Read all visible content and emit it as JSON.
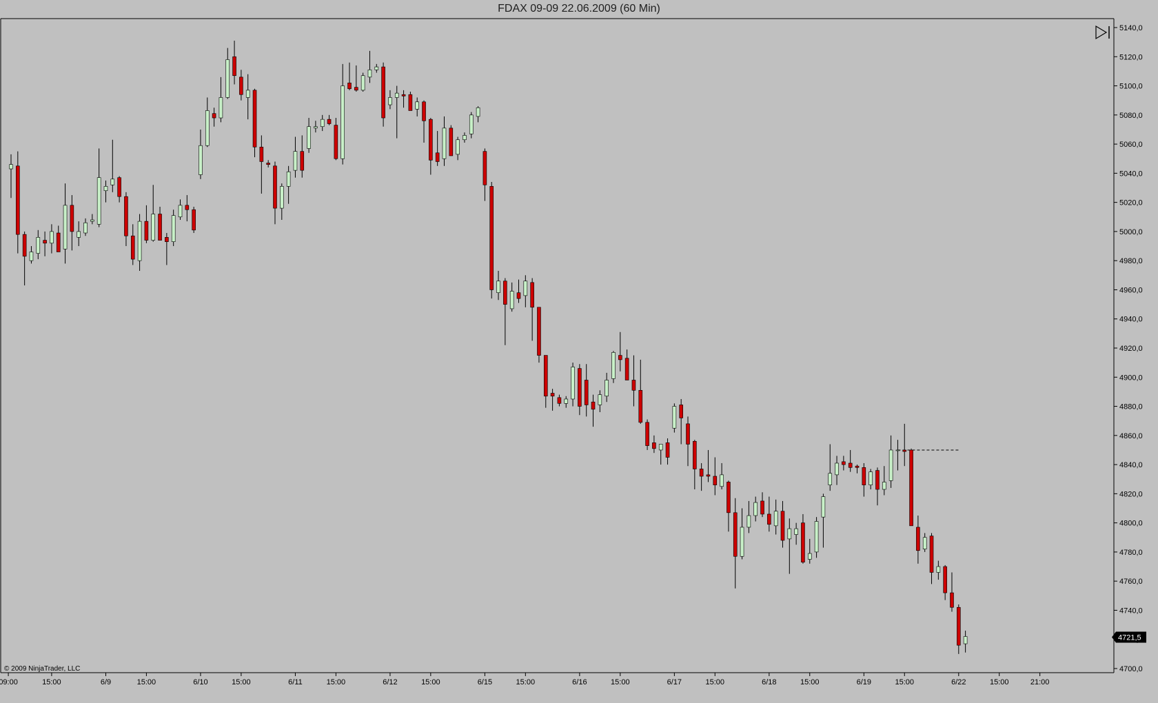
{
  "window": {
    "title": "FDAX 09-09  22.06.2009 (60 Min)"
  },
  "copyright": "© 2009 NinjaTrader, LLC",
  "colors": {
    "background": "#c0c0c0",
    "up": "#c8f0c8",
    "down": "#cc0000",
    "wick": "#000000",
    "outline": "#000000"
  },
  "icons": {
    "scroll_end": "play-to-end-icon"
  },
  "chart_data": {
    "type": "candlestick",
    "title": "FDAX 09-09  22.06.2009 (60 Min)",
    "ylim": [
      4697,
      5144
    ],
    "y_ticks": [
      {
        "value": 5140,
        "label": "5140,0"
      },
      {
        "value": 5120,
        "label": "5120,0"
      },
      {
        "value": 5100,
        "label": "5100,0"
      },
      {
        "value": 5080,
        "label": "5080,0"
      },
      {
        "value": 5060,
        "label": "5060,0"
      },
      {
        "value": 5040,
        "label": "5040,0"
      },
      {
        "value": 5020,
        "label": "5020,0"
      },
      {
        "value": 5000,
        "label": "5000,0"
      },
      {
        "value": 4980,
        "label": "4980,0"
      },
      {
        "value": 4960,
        "label": "4960,0"
      },
      {
        "value": 4940,
        "label": "4940,0"
      },
      {
        "value": 4920,
        "label": "4920,0"
      },
      {
        "value": 4900,
        "label": "4900,0"
      },
      {
        "value": 4880,
        "label": "4880,0"
      },
      {
        "value": 4860,
        "label": "4860,0"
      },
      {
        "value": 4840,
        "label": "4840,0"
      },
      {
        "value": 4820,
        "label": "4820,0"
      },
      {
        "value": 4800,
        "label": "4800,0"
      },
      {
        "value": 4780,
        "label": "4780,0"
      },
      {
        "value": 4760,
        "label": "4760,0"
      },
      {
        "value": 4740,
        "label": "4740,0"
      },
      {
        "value": 4720,
        "label": "4720,0"
      },
      {
        "value": 4700,
        "label": "4700,0"
      }
    ],
    "x_ticks": [
      {
        "bar": -0.4,
        "label": "09:00"
      },
      {
        "bar": 6,
        "label": "15:00"
      },
      {
        "bar": 14,
        "label": "6/9"
      },
      {
        "bar": 20,
        "label": "15:00"
      },
      {
        "bar": 28,
        "label": "6/10"
      },
      {
        "bar": 34,
        "label": "15:00"
      },
      {
        "bar": 42,
        "label": "6/11"
      },
      {
        "bar": 48,
        "label": "15:00"
      },
      {
        "bar": 56,
        "label": "6/12"
      },
      {
        "bar": 62,
        "label": "15:00"
      },
      {
        "bar": 70,
        "label": "6/15"
      },
      {
        "bar": 76,
        "label": "15:00"
      },
      {
        "bar": 84,
        "label": "6/16"
      },
      {
        "bar": 90,
        "label": "15:00"
      },
      {
        "bar": 98,
        "label": "6/17"
      },
      {
        "bar": 104,
        "label": "15:00"
      },
      {
        "bar": 112,
        "label": "6/18"
      },
      {
        "bar": 118,
        "label": "15:00"
      },
      {
        "bar": 126,
        "label": "6/19"
      },
      {
        "bar": 132,
        "label": "15:00"
      },
      {
        "bar": 140,
        "label": "6/22"
      },
      {
        "bar": 146,
        "label": "15:00"
      },
      {
        "bar": 152,
        "label": "21:00"
      }
    ],
    "last_price": {
      "value": 4721.5,
      "label": "4721,5"
    },
    "gap_line": {
      "from_bar": 131,
      "to_bar": 140,
      "value": 4850
    },
    "candles": [
      {
        "o": 5043,
        "h": 5053,
        "l": 5023,
        "c": 5046
      },
      {
        "o": 5045,
        "h": 5055,
        "l": 4985,
        "c": 4998
      },
      {
        "o": 4998,
        "h": 5000,
        "l": 4963,
        "c": 4983
      },
      {
        "o": 4980,
        "h": 4990,
        "l": 4978,
        "c": 4986
      },
      {
        "o": 4985,
        "h": 5001,
        "l": 4981,
        "c": 4996
      },
      {
        "o": 4994,
        "h": 5000,
        "l": 4983,
        "c": 4992
      },
      {
        "o": 4992,
        "h": 5005,
        "l": 4985,
        "c": 5000
      },
      {
        "o": 4999,
        "h": 5004,
        "l": 4986,
        "c": 4986
      },
      {
        "o": 4988,
        "h": 5033,
        "l": 4978,
        "c": 5018
      },
      {
        "o": 5018,
        "h": 5025,
        "l": 4987,
        "c": 5000
      },
      {
        "o": 4996,
        "h": 5007,
        "l": 4990,
        "c": 5000
      },
      {
        "o": 4999,
        "h": 5009,
        "l": 4997,
        "c": 5006
      },
      {
        "o": 5007,
        "h": 5012,
        "l": 5005,
        "c": 5008
      },
      {
        "o": 5005,
        "h": 5057,
        "l": 5003,
        "c": 5037
      },
      {
        "o": 5028,
        "h": 5035,
        "l": 5020,
        "c": 5031
      },
      {
        "o": 5032,
        "h": 5063,
        "l": 5027,
        "c": 5036
      },
      {
        "o": 5037,
        "h": 5038,
        "l": 5020,
        "c": 5024
      },
      {
        "o": 5024,
        "h": 5027,
        "l": 4990,
        "c": 4997
      },
      {
        "o": 4997,
        "h": 5005,
        "l": 4977,
        "c": 4981
      },
      {
        "o": 4980,
        "h": 5012,
        "l": 4973,
        "c": 5007
      },
      {
        "o": 5007,
        "h": 5018,
        "l": 4992,
        "c": 4994
      },
      {
        "o": 4994,
        "h": 5032,
        "l": 4993,
        "c": 5012
      },
      {
        "o": 5012,
        "h": 5017,
        "l": 4995,
        "c": 4994
      },
      {
        "o": 4996,
        "h": 4999,
        "l": 4977,
        "c": 4993
      },
      {
        "o": 4993,
        "h": 5015,
        "l": 4990,
        "c": 5011
      },
      {
        "o": 5010,
        "h": 5022,
        "l": 5008,
        "c": 5018
      },
      {
        "o": 5018,
        "h": 5025,
        "l": 5007,
        "c": 5015
      },
      {
        "o": 5015,
        "h": 5017,
        "l": 4999,
        "c": 5001
      },
      {
        "o": 5039,
        "h": 5070,
        "l": 5036,
        "c": 5059
      },
      {
        "o": 5059,
        "h": 5092,
        "l": 5058,
        "c": 5083
      },
      {
        "o": 5081,
        "h": 5085,
        "l": 5072,
        "c": 5078
      },
      {
        "o": 5078,
        "h": 5106,
        "l": 5075,
        "c": 5092
      },
      {
        "o": 5092,
        "h": 5126,
        "l": 5091,
        "c": 5118
      },
      {
        "o": 5120,
        "h": 5131,
        "l": 5101,
        "c": 5107
      },
      {
        "o": 5106,
        "h": 5111,
        "l": 5090,
        "c": 5094
      },
      {
        "o": 5092,
        "h": 5108,
        "l": 5077,
        "c": 5097
      },
      {
        "o": 5097,
        "h": 5098,
        "l": 5051,
        "c": 5058
      },
      {
        "o": 5058,
        "h": 5066,
        "l": 5026,
        "c": 5048
      },
      {
        "o": 5047,
        "h": 5049,
        "l": 5044,
        "c": 5046
      },
      {
        "o": 5045,
        "h": 5048,
        "l": 5005,
        "c": 5016
      },
      {
        "o": 5016,
        "h": 5033,
        "l": 5008,
        "c": 5031
      },
      {
        "o": 5031,
        "h": 5045,
        "l": 5019,
        "c": 5041
      },
      {
        "o": 5042,
        "h": 5065,
        "l": 5037,
        "c": 5055
      },
      {
        "o": 5055,
        "h": 5066,
        "l": 5037,
        "c": 5042
      },
      {
        "o": 5057,
        "h": 5078,
        "l": 5054,
        "c": 5072
      },
      {
        "o": 5071,
        "h": 5076,
        "l": 5068,
        "c": 5072
      },
      {
        "o": 5072,
        "h": 5080,
        "l": 5069,
        "c": 5077
      },
      {
        "o": 5077,
        "h": 5080,
        "l": 5073,
        "c": 5074
      },
      {
        "o": 5073,
        "h": 5078,
        "l": 5049,
        "c": 5050
      },
      {
        "o": 5050,
        "h": 5115,
        "l": 5046,
        "c": 5100
      },
      {
        "o": 5102,
        "h": 5116,
        "l": 5097,
        "c": 5098
      },
      {
        "o": 5099,
        "h": 5114,
        "l": 5096,
        "c": 5097
      },
      {
        "o": 5097,
        "h": 5109,
        "l": 5096,
        "c": 5107
      },
      {
        "o": 5106,
        "h": 5124,
        "l": 5102,
        "c": 5111
      },
      {
        "o": 5111,
        "h": 5115,
        "l": 5109,
        "c": 5113
      },
      {
        "o": 5113,
        "h": 5116,
        "l": 5072,
        "c": 5078
      },
      {
        "o": 5087,
        "h": 5097,
        "l": 5084,
        "c": 5092
      },
      {
        "o": 5092,
        "h": 5100,
        "l": 5064,
        "c": 5095
      },
      {
        "o": 5094,
        "h": 5097,
        "l": 5085,
        "c": 5093
      },
      {
        "o": 5094,
        "h": 5096,
        "l": 5083,
        "c": 5083
      },
      {
        "o": 5084,
        "h": 5092,
        "l": 5079,
        "c": 5089
      },
      {
        "o": 5089,
        "h": 5090,
        "l": 5061,
        "c": 5076
      },
      {
        "o": 5077,
        "h": 5078,
        "l": 5039,
        "c": 5049
      },
      {
        "o": 5054,
        "h": 5069,
        "l": 5045,
        "c": 5048
      },
      {
        "o": 5050,
        "h": 5079,
        "l": 5045,
        "c": 5071
      },
      {
        "o": 5071,
        "h": 5073,
        "l": 5052,
        "c": 5052
      },
      {
        "o": 5053,
        "h": 5065,
        "l": 5049,
        "c": 5063
      },
      {
        "o": 5063,
        "h": 5068,
        "l": 5061,
        "c": 5066
      },
      {
        "o": 5067,
        "h": 5082,
        "l": 5064,
        "c": 5080
      },
      {
        "o": 5079,
        "h": 5086,
        "l": 5075,
        "c": 5085
      },
      {
        "o": 5055,
        "h": 5057,
        "l": 5021,
        "c": 5032
      },
      {
        "o": 5031,
        "h": 5034,
        "l": 4954,
        "c": 4960
      },
      {
        "o": 4958,
        "h": 4973,
        "l": 4953,
        "c": 4966
      },
      {
        "o": 4966,
        "h": 4968,
        "l": 4922,
        "c": 4950
      },
      {
        "o": 4947,
        "h": 4965,
        "l": 4945,
        "c": 4959
      },
      {
        "o": 4958,
        "h": 4967,
        "l": 4951,
        "c": 4954
      },
      {
        "o": 4956,
        "h": 4970,
        "l": 4948,
        "c": 4966
      },
      {
        "o": 4965,
        "h": 4968,
        "l": 4925,
        "c": 4948
      },
      {
        "o": 4948,
        "h": 4948,
        "l": 4910,
        "c": 4915
      },
      {
        "o": 4915,
        "h": 4915,
        "l": 4879,
        "c": 4887
      },
      {
        "o": 4889,
        "h": 4892,
        "l": 4877,
        "c": 4887
      },
      {
        "o": 4886,
        "h": 4888,
        "l": 4880,
        "c": 4882
      },
      {
        "o": 4882,
        "h": 4887,
        "l": 4879,
        "c": 4885
      },
      {
        "o": 4885,
        "h": 4910,
        "l": 4880,
        "c": 4907
      },
      {
        "o": 4906,
        "h": 4909,
        "l": 4874,
        "c": 4880
      },
      {
        "o": 4898,
        "h": 4909,
        "l": 4873,
        "c": 4881
      },
      {
        "o": 4883,
        "h": 4888,
        "l": 4866,
        "c": 4878
      },
      {
        "o": 4881,
        "h": 4891,
        "l": 4876,
        "c": 4888
      },
      {
        "o": 4887,
        "h": 4903,
        "l": 4883,
        "c": 4898
      },
      {
        "o": 4899,
        "h": 4918,
        "l": 4896,
        "c": 4917
      },
      {
        "o": 4915,
        "h": 4931,
        "l": 4904,
        "c": 4912
      },
      {
        "o": 4913,
        "h": 4919,
        "l": 4898,
        "c": 4898
      },
      {
        "o": 4898,
        "h": 4915,
        "l": 4880,
        "c": 4891
      },
      {
        "o": 4891,
        "h": 4912,
        "l": 4868,
        "c": 4869
      },
      {
        "o": 4869,
        "h": 4871,
        "l": 4850,
        "c": 4853
      },
      {
        "o": 4855,
        "h": 4860,
        "l": 4848,
        "c": 4851
      },
      {
        "o": 4850,
        "h": 4854,
        "l": 4840,
        "c": 4854
      },
      {
        "o": 4855,
        "h": 4858,
        "l": 4840,
        "c": 4845
      },
      {
        "o": 4865,
        "h": 4882,
        "l": 4862,
        "c": 4880
      },
      {
        "o": 4881,
        "h": 4885,
        "l": 4854,
        "c": 4872
      },
      {
        "o": 4868,
        "h": 4873,
        "l": 4839,
        "c": 4854
      },
      {
        "o": 4856,
        "h": 4857,
        "l": 4823,
        "c": 4837
      },
      {
        "o": 4837,
        "h": 4841,
        "l": 4822,
        "c": 4832
      },
      {
        "o": 4833,
        "h": 4850,
        "l": 4828,
        "c": 4832
      },
      {
        "o": 4832,
        "h": 4845,
        "l": 4819,
        "c": 4826
      },
      {
        "o": 4825,
        "h": 4841,
        "l": 4823,
        "c": 4833
      },
      {
        "o": 4828,
        "h": 4829,
        "l": 4794,
        "c": 4807
      },
      {
        "o": 4807,
        "h": 4817,
        "l": 4755,
        "c": 4777
      },
      {
        "o": 4777,
        "h": 4810,
        "l": 4775,
        "c": 4797
      },
      {
        "o": 4797,
        "h": 4815,
        "l": 4793,
        "c": 4805
      },
      {
        "o": 4805,
        "h": 4818,
        "l": 4801,
        "c": 4814
      },
      {
        "o": 4815,
        "h": 4821,
        "l": 4804,
        "c": 4806
      },
      {
        "o": 4806,
        "h": 4818,
        "l": 4794,
        "c": 4799
      },
      {
        "o": 4798,
        "h": 4816,
        "l": 4792,
        "c": 4808
      },
      {
        "o": 4808,
        "h": 4815,
        "l": 4783,
        "c": 4788
      },
      {
        "o": 4789,
        "h": 4803,
        "l": 4765,
        "c": 4796
      },
      {
        "o": 4792,
        "h": 4800,
        "l": 4785,
        "c": 4796
      },
      {
        "o": 4800,
        "h": 4806,
        "l": 4772,
        "c": 4773
      },
      {
        "o": 4775,
        "h": 4789,
        "l": 4772,
        "c": 4779
      },
      {
        "o": 4780,
        "h": 4804,
        "l": 4776,
        "c": 4801
      },
      {
        "o": 4804,
        "h": 4820,
        "l": 4783,
        "c": 4818
      },
      {
        "o": 4826,
        "h": 4854,
        "l": 4822,
        "c": 4834
      },
      {
        "o": 4833,
        "h": 4846,
        "l": 4826,
        "c": 4841
      },
      {
        "o": 4842,
        "h": 4846,
        "l": 4836,
        "c": 4840
      },
      {
        "o": 4841,
        "h": 4850,
        "l": 4835,
        "c": 4838
      },
      {
        "o": 4839,
        "h": 4840,
        "l": 4834,
        "c": 4838
      },
      {
        "o": 4838,
        "h": 4841,
        "l": 4818,
        "c": 4826
      },
      {
        "o": 4826,
        "h": 4837,
        "l": 4823,
        "c": 4835
      },
      {
        "o": 4836,
        "h": 4838,
        "l": 4812,
        "c": 4823
      },
      {
        "o": 4823,
        "h": 4839,
        "l": 4819,
        "c": 4828
      },
      {
        "o": 4829,
        "h": 4860,
        "l": 4824,
        "c": 4850
      },
      {
        "o": 4850,
        "h": 4857,
        "l": 4836,
        "c": 4850
      },
      {
        "o": 4850,
        "h": 4868,
        "l": 4839,
        "c": 4849
      },
      {
        "o": 4850,
        "h": 4851,
        "l": 4813,
        "c": 4798
      },
      {
        "o": 4797,
        "h": 4805,
        "l": 4772,
        "c": 4781
      },
      {
        "o": 4782,
        "h": 4793,
        "l": 4780,
        "c": 4790
      },
      {
        "o": 4791,
        "h": 4793,
        "l": 4758,
        "c": 4766
      },
      {
        "o": 4766,
        "h": 4774,
        "l": 4761,
        "c": 4770
      },
      {
        "o": 4770,
        "h": 4771,
        "l": 4747,
        "c": 4752
      },
      {
        "o": 4752,
        "h": 4766,
        "l": 4739,
        "c": 4742
      },
      {
        "o": 4742,
        "h": 4744,
        "l": 4710,
        "c": 4716
      },
      {
        "o": 4717,
        "h": 4726,
        "l": 4711,
        "c": 4722
      }
    ]
  }
}
